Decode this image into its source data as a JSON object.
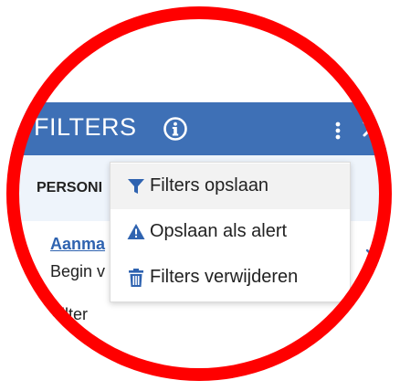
{
  "header": {
    "title": "FILTERS",
    "info_icon": "info-circle-icon",
    "menu_icon": "kebab-vertical-icon",
    "close_icon": "close-icon",
    "background": "#3e70b6"
  },
  "section": {
    "title": "PERSONI"
  },
  "filter": {
    "link": "Aanma",
    "desc": "Begin v",
    "label": "Filter"
  },
  "menu": {
    "items": [
      {
        "icon": "filter-funnel-icon",
        "label": "Filters opslaan"
      },
      {
        "icon": "warning-triangle-icon",
        "label": "Opslaan als alert"
      },
      {
        "icon": "trash-icon",
        "label": "Filters verwijderen"
      }
    ]
  },
  "highlight_color": "#ff0000"
}
